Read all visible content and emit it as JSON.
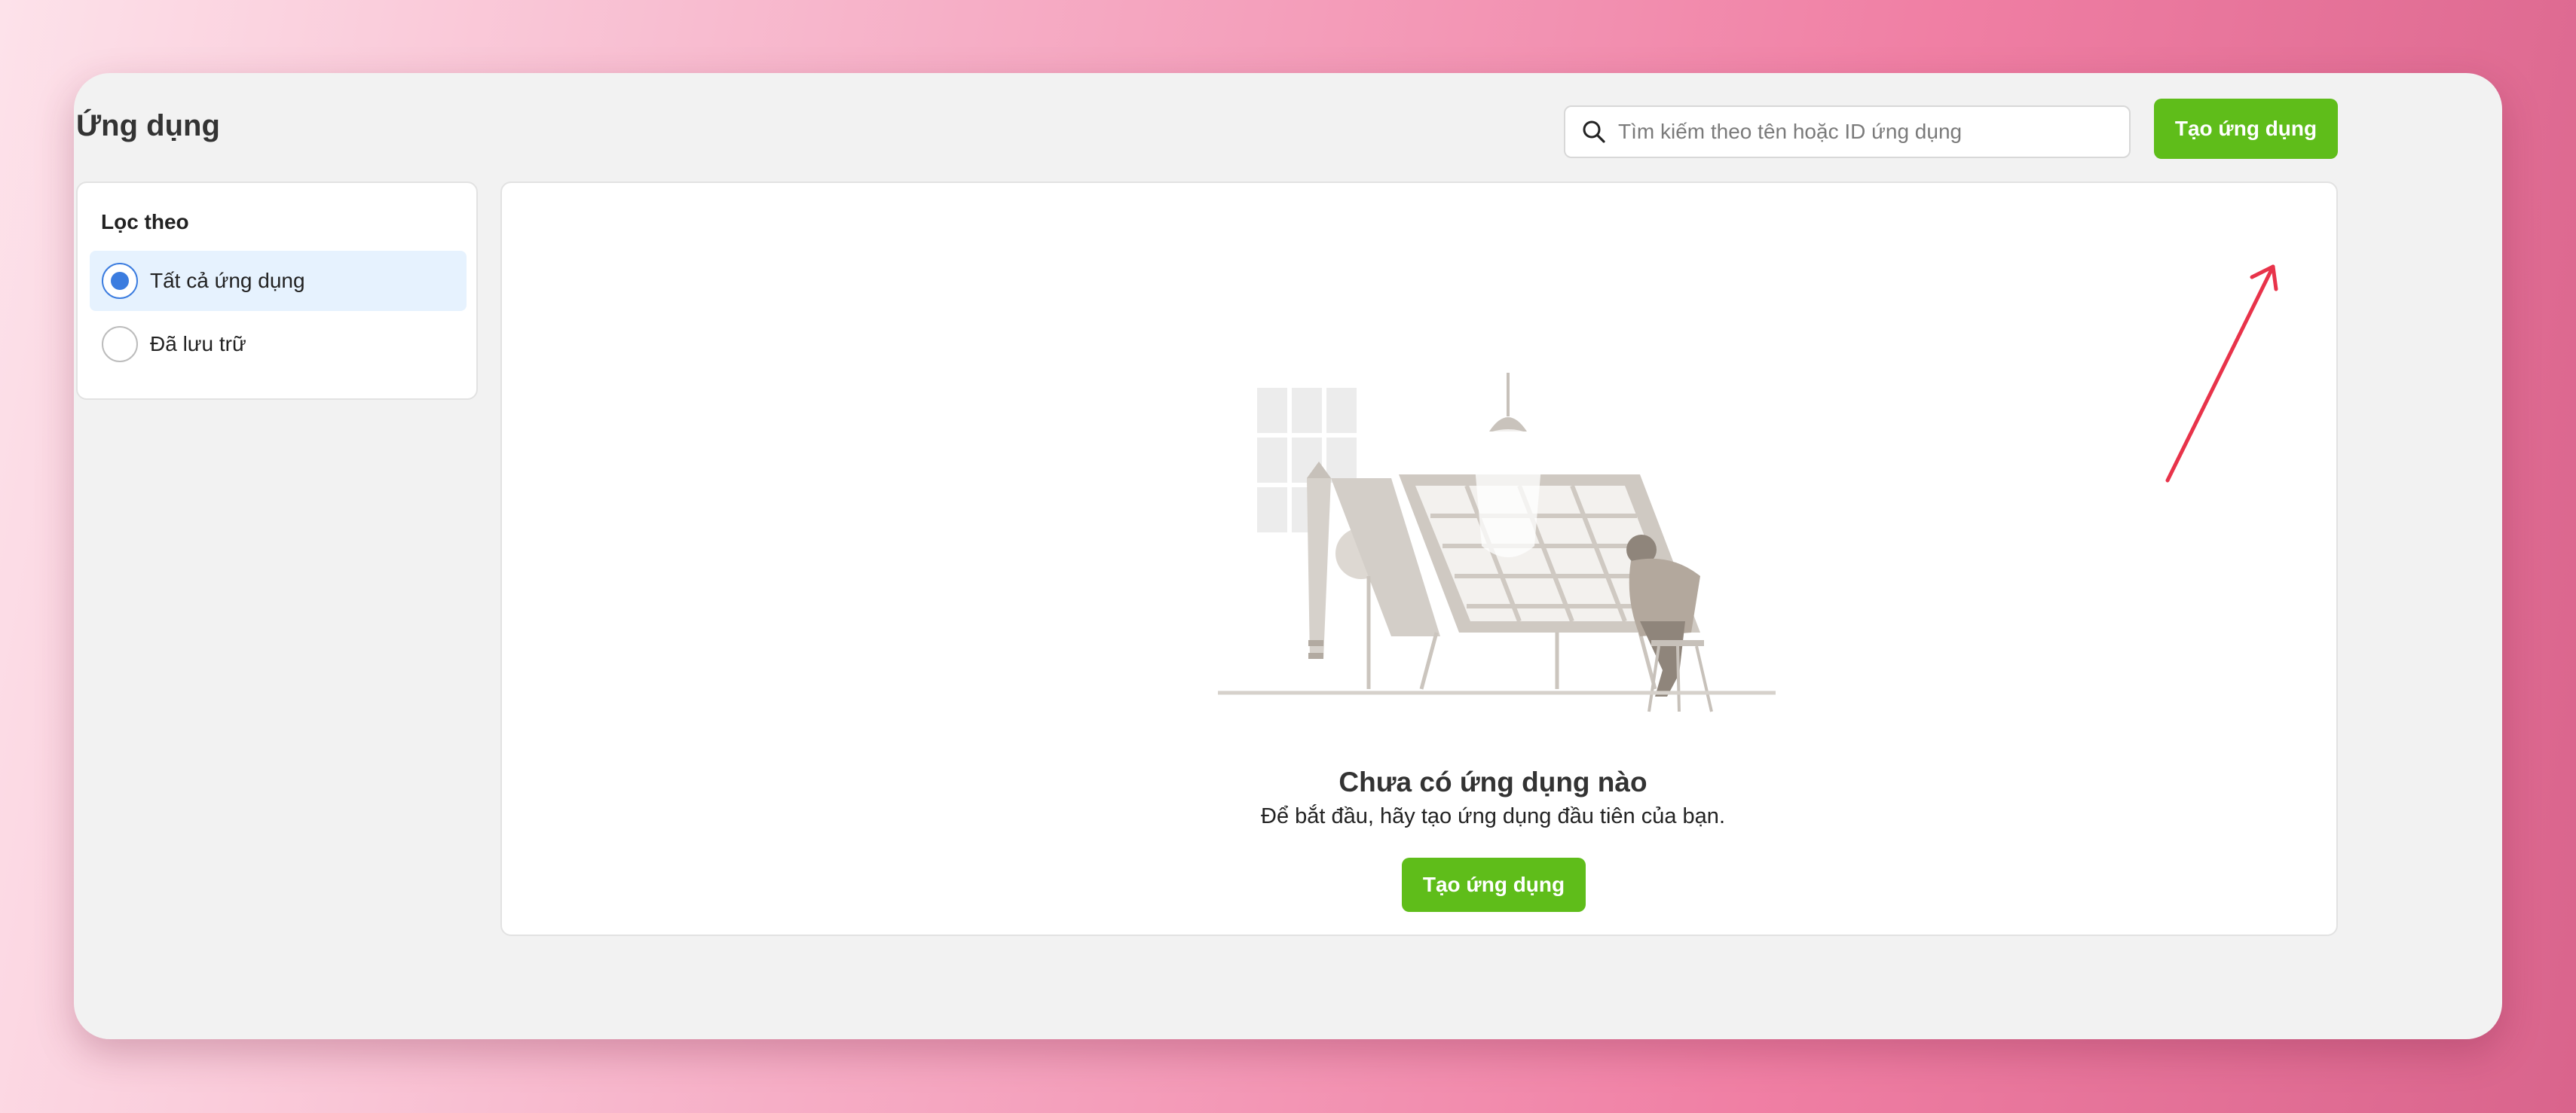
{
  "page": {
    "title": "Ứng dụng"
  },
  "search": {
    "placeholder": "Tìm kiếm theo tên hoặc ID ứng dụng",
    "icon": "search-icon"
  },
  "header": {
    "create_button": "Tạo ứng dụng"
  },
  "filter": {
    "heading": "Lọc theo",
    "options": [
      {
        "label": "Tất cả ứng dụng",
        "selected": true
      },
      {
        "label": "Đã lưu trữ",
        "selected": false
      }
    ]
  },
  "empty_state": {
    "title": "Chưa có ứng dụng nào",
    "subtitle": "Để bắt đầu, hãy tạo ứng dụng đầu tiên của bạn.",
    "create_button": "Tạo ứng dụng"
  },
  "colors": {
    "accent_green": "#5fbd1a",
    "radio_blue": "#3b7cdf",
    "selected_bg": "#e6f2fe",
    "annotation_arrow": "#e8334a"
  }
}
